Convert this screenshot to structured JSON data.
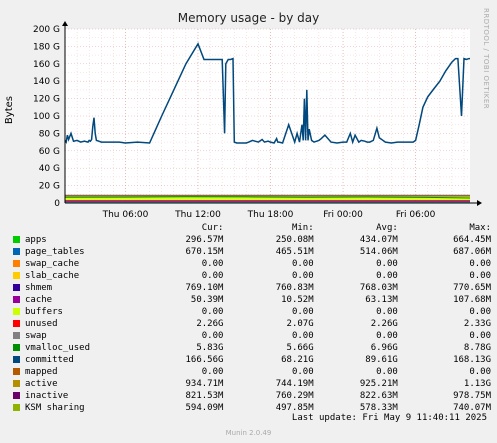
{
  "title": "Memory usage - by day",
  "side_label": "RRDTOOL / TOBI OETIKER",
  "footer": {
    "last_update": "Last update:  Fri May  9 11:40:11 2025",
    "munin": "Munin 2.0.49"
  },
  "legend_headers": {
    "cur": "Cur:",
    "min": "Min:",
    "avg": "Avg:",
    "max": "Max:"
  },
  "legend": [
    {
      "name": "apps",
      "color": "#00cc00",
      "cur": "296.57M",
      "min": "250.08M",
      "avg": "434.07M",
      "max": "664.45M"
    },
    {
      "name": "page_tables",
      "color": "#0066b3",
      "cur": "670.15M",
      "min": "465.51M",
      "avg": "514.06M",
      "max": "687.06M"
    },
    {
      "name": "swap_cache",
      "color": "#ff8000",
      "cur": "0.00",
      "min": "0.00",
      "avg": "0.00",
      "max": "0.00"
    },
    {
      "name": "slab_cache",
      "color": "#ffcc00",
      "cur": "0.00",
      "min": "0.00",
      "avg": "0.00",
      "max": "0.00"
    },
    {
      "name": "shmem",
      "color": "#330099",
      "cur": "769.10M",
      "min": "760.83M",
      "avg": "768.03M",
      "max": "770.65M"
    },
    {
      "name": "cache",
      "color": "#990099",
      "cur": "50.39M",
      "min": "10.52M",
      "avg": "63.13M",
      "max": "107.68M"
    },
    {
      "name": "buffers",
      "color": "#ccff00",
      "cur": "0.00",
      "min": "0.00",
      "avg": "0.00",
      "max": "0.00"
    },
    {
      "name": "unused",
      "color": "#ff0000",
      "cur": "2.26G",
      "min": "2.07G",
      "avg": "2.26G",
      "max": "2.33G"
    },
    {
      "name": "swap",
      "color": "#808080",
      "cur": "0.00",
      "min": "0.00",
      "avg": "0.00",
      "max": "0.00"
    },
    {
      "name": "vmalloc_used",
      "color": "#008f00",
      "cur": "5.83G",
      "min": "5.66G",
      "avg": "6.96G",
      "max": "8.78G"
    },
    {
      "name": "committed",
      "color": "#00487d",
      "cur": "166.56G",
      "min": "68.21G",
      "avg": "89.61G",
      "max": "168.13G"
    },
    {
      "name": "mapped",
      "color": "#b35a00",
      "cur": "0.00",
      "min": "0.00",
      "avg": "0.00",
      "max": "0.00"
    },
    {
      "name": "active",
      "color": "#b38f00",
      "cur": "934.71M",
      "min": "744.19M",
      "avg": "925.21M",
      "max": "1.13G"
    },
    {
      "name": "inactive",
      "color": "#6b006b",
      "cur": "821.53M",
      "min": "760.29M",
      "avg": "822.63M",
      "max": "978.75M"
    },
    {
      "name": "KSM sharing",
      "color": "#8fb300",
      "cur": "594.09M",
      "min": "497.85M",
      "avg": "578.33M",
      "max": "740.07M"
    }
  ],
  "chart_data": {
    "type": "line",
    "ylabel": "Bytes",
    "ylim": [
      0,
      200
    ],
    "yunit": "G",
    "y_ticks": [
      0,
      20,
      40,
      60,
      80,
      100,
      120,
      140,
      160,
      180,
      200
    ],
    "y_tick_labels": [
      "0",
      "20 G",
      "40 G",
      "60 G",
      "80 G",
      "100 G",
      "120 G",
      "140 G",
      "160 G",
      "180 G",
      "200 G"
    ],
    "xlim": [
      0,
      28
    ],
    "x_ticks": [
      5,
      11,
      17,
      23,
      29
    ],
    "x_tick_labels": [
      "Thu 06:00",
      "Thu 12:00",
      "Thu 18:00",
      "Fri 00:00",
      "Fri 06:00"
    ],
    "grid": true,
    "series": [
      {
        "name": "committed",
        "color": "#00487d",
        "x": [
          0,
          0.1,
          0.2,
          0.3,
          0.5,
          0.7,
          1.0,
          1.3,
          1.6,
          1.9,
          2.0,
          2.1,
          2.2,
          2.3,
          2.4,
          2.5,
          2.6,
          2.8,
          3.0,
          3.5,
          4.0,
          4.5,
          5.0,
          6.0,
          7.0,
          8.0,
          9.0,
          10.0,
          11.0,
          11.5,
          12.5,
          13.0,
          13.2,
          13.3,
          13.5,
          13.7,
          13.9,
          14.0,
          14.2,
          14.5,
          15.0,
          15.2,
          15.5,
          16.0,
          16.3,
          16.5,
          16.8,
          17.0,
          17.3,
          17.5,
          17.6,
          17.7,
          18.0,
          18.5,
          19.0,
          19.2,
          19.4,
          19.6,
          19.7,
          19.8,
          19.9,
          20.0,
          20.1,
          20.2,
          20.4,
          20.6,
          21.0,
          21.2,
          21.5,
          22.0,
          22.5,
          23.0,
          23.3,
          23.6,
          23.8,
          24.0,
          24.3,
          24.5,
          24.8,
          25.0,
          25.2,
          25.5,
          25.8,
          26.0,
          26.5,
          27.0,
          27.5,
          28.0,
          28.3,
          28.6,
          28.8,
          29.0,
          29.3,
          29.6,
          30.0,
          30.5,
          31.0,
          31.5,
          32.0,
          32.3,
          32.5,
          32.8,
          33.0,
          33.2,
          33.4,
          33.5
        ],
        "y": [
          72,
          70,
          78,
          73,
          80,
          71,
          72,
          70,
          71,
          70,
          72,
          71,
          73,
          88,
          98,
          80,
          72,
          71,
          70,
          70,
          70,
          70,
          69,
          70,
          69,
          100,
          130,
          160,
          183,
          165,
          165,
          165,
          80,
          160,
          165,
          165,
          166,
          70,
          69,
          69,
          69,
          70,
          72,
          70,
          73,
          70,
          71,
          70,
          69,
          74,
          70,
          70,
          69,
          90,
          70,
          80,
          70,
          90,
          72,
          120,
          72,
          130,
          72,
          85,
          72,
          70,
          72,
          74,
          78,
          70,
          69,
          70,
          70,
          80,
          70,
          78,
          70,
          72,
          71,
          70,
          70,
          72,
          86,
          75,
          70,
          69,
          70,
          70,
          70,
          70,
          70,
          72,
          90,
          110,
          122,
          131,
          140,
          152,
          162,
          166,
          166,
          100,
          166,
          165,
          166,
          166
        ]
      },
      {
        "name": "vmalloc_used",
        "color": "#008f00",
        "x": [
          0,
          5,
          10,
          15,
          20,
          25,
          30,
          33.5
        ],
        "y": [
          6.5,
          6.8,
          7.2,
          7.0,
          6.6,
          6.9,
          6.4,
          5.8
        ]
      }
    ]
  }
}
